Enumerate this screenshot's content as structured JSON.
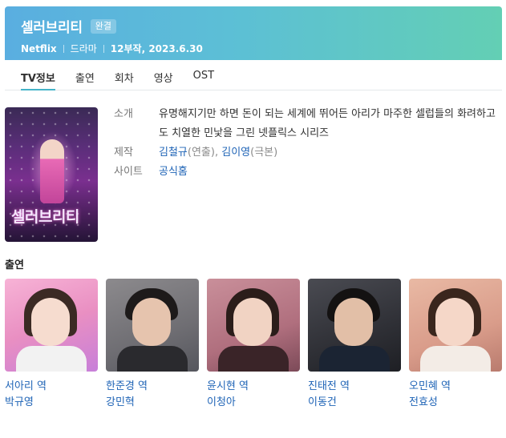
{
  "header": {
    "title": "셀러브리티",
    "badge": "완결",
    "platform": "Netflix",
    "genre": "드라마",
    "episodes_date": "12부작, 2023.6.30"
  },
  "tabs": [
    {
      "label": "TV정보",
      "active": true
    },
    {
      "label": "출연",
      "active": false
    },
    {
      "label": "회차",
      "active": false
    },
    {
      "label": "영상",
      "active": false
    },
    {
      "label": "OST",
      "active": false
    }
  ],
  "poster": {
    "title_text": "셀러브리티"
  },
  "info": {
    "synopsis_label": "소개",
    "synopsis": "유명해지기만 하면 돈이 되는 세계에 뛰어든 아리가 마주한 셀럽들의 화려하고도 치열한 민낯을 그린 넷플릭스 시리즈",
    "production_label": "제작",
    "director": "김철규",
    "director_role": "(연출), ",
    "writer": "김이영",
    "writer_role": "(극본)",
    "site_label": "사이트",
    "site_link": "공식홈"
  },
  "cast": {
    "heading": "출연",
    "items": [
      {
        "character": "서아리 역",
        "actor": "박규영"
      },
      {
        "character": "한준경 역",
        "actor": "강민혁"
      },
      {
        "character": "윤시현 역",
        "actor": "이청아"
      },
      {
        "character": "진태전 역",
        "actor": "이동건"
      },
      {
        "character": "오민혜 역",
        "actor": "전효성"
      }
    ]
  },
  "colors": {
    "banner_start": "#5aaee0",
    "banner_end": "#63cfb4",
    "link": "#1e63b6",
    "tab_indicator": "#45b4c8"
  }
}
